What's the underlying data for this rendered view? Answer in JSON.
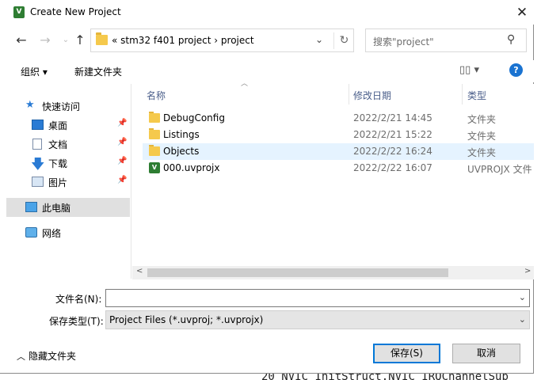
{
  "window": {
    "title": "Create New Project",
    "app_icon": "uv-icon"
  },
  "nav": {
    "back": "←",
    "forward": "→",
    "up": "↑",
    "breadcrumb": "« stm32 f401 project › project",
    "chevron": "⌄",
    "refresh": "↻"
  },
  "search": {
    "placeholder": "搜索\"project\"",
    "icon": "⚲"
  },
  "toolbar": {
    "organize": "组织 ▾",
    "new_folder": "新建文件夹",
    "view": "▯▯ ▾",
    "help": "?"
  },
  "navpane": {
    "items": [
      {
        "label": "快速访问",
        "icon": "star-icon"
      },
      {
        "label": "桌面",
        "icon": "desktop-icon",
        "pinned": true
      },
      {
        "label": "文档",
        "icon": "document-icon",
        "pinned": true
      },
      {
        "label": "下载",
        "icon": "download-icon",
        "pinned": true
      },
      {
        "label": "图片",
        "icon": "pictures-icon",
        "pinned": true
      },
      {
        "label": "此电脑",
        "icon": "computer-icon",
        "selected": true
      },
      {
        "label": "网络",
        "icon": "network-icon"
      }
    ],
    "pin_glyph": "📌"
  },
  "filelist": {
    "columns": {
      "name": "名称",
      "date": "修改日期",
      "type": "类型"
    },
    "rows": [
      {
        "name": "DebugConfig",
        "date": "2022/2/21 14:45",
        "type": "文件夹",
        "icon": "folder-icon"
      },
      {
        "name": "Listings",
        "date": "2022/2/21 15:22",
        "type": "文件夹",
        "icon": "folder-icon"
      },
      {
        "name": "Objects",
        "date": "2022/2/22 16:24",
        "type": "文件夹",
        "icon": "folder-icon",
        "highlighted": true
      },
      {
        "name": "000.uvprojx",
        "date": "2022/2/22 16:07",
        "type": "UVPROJX 文件",
        "icon": "uvprojx-file-icon"
      }
    ],
    "scroll_left": "<",
    "scroll_right": ">"
  },
  "form": {
    "filename_label": "文件名(N):",
    "filename_value": "",
    "filetype_label": "保存类型(T):",
    "filetype_value": "Project Files (*.uvproj; *.uvprojx)"
  },
  "footer": {
    "hide_folders": "隐藏文件夹",
    "save": "保存(S)",
    "cancel": "取消"
  },
  "background_code": {
    "line_number": "20",
    "code": "NVIC_InitStruct.NVIC_IRQChannelSub"
  },
  "colors": {
    "accent": "#0078d7",
    "selection": "#e5f3ff",
    "help": "#1a73d1",
    "folder": "#f5c94c",
    "uv_green": "#2e7d32"
  }
}
